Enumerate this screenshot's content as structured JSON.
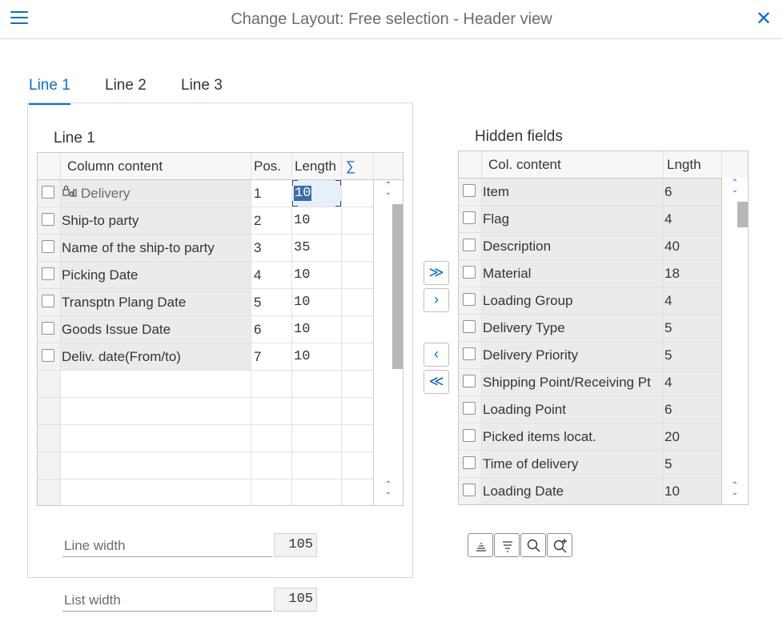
{
  "header": {
    "title": "Change Layout: Free selection - Header view",
    "menu_icon": "hamburger-icon",
    "close_icon": "close-icon",
    "close_glyph": "✕"
  },
  "tabs": [
    {
      "label": "Line 1",
      "active": true
    },
    {
      "label": "Line 2",
      "active": false
    },
    {
      "label": "Line 3",
      "active": false
    }
  ],
  "line_panel": {
    "title": "Line 1",
    "columns": {
      "content": "Column content",
      "pos": "Pos.",
      "length": "Length",
      "sum": "∑"
    },
    "rows": [
      {
        "content": "Delivery",
        "pos": "1",
        "length": "10",
        "key_icon": true
      },
      {
        "content": "Ship-to party",
        "pos": "2",
        "length": "10"
      },
      {
        "content": "Name of the ship-to party",
        "pos": "3",
        "length": "35"
      },
      {
        "content": "Picking Date",
        "pos": "4",
        "length": "10"
      },
      {
        "content": "Transptn Plang Date",
        "pos": "5",
        "length": "10"
      },
      {
        "content": "Goods Issue Date",
        "pos": "6",
        "length": "10"
      },
      {
        "content": "Deliv. date(From/to)",
        "pos": "7",
        "length": "10"
      }
    ],
    "line_width": {
      "label": "Line width",
      "value": "105"
    }
  },
  "list_width": {
    "label": "List width",
    "value": "105"
  },
  "move_buttons": {
    "add_all": "≫",
    "add_one": "›",
    "remove_one": "‹",
    "remove_all": "≪"
  },
  "hidden_panel": {
    "title": "Hidden fields",
    "columns": {
      "content": "Col. content",
      "length": "Lngth"
    },
    "rows": [
      {
        "content": "Item",
        "length": "6"
      },
      {
        "content": "Flag",
        "length": "4"
      },
      {
        "content": "Description",
        "length": "40"
      },
      {
        "content": "Material",
        "length": "18"
      },
      {
        "content": "Loading Group",
        "length": "4"
      },
      {
        "content": "Delivery Type",
        "length": "5"
      },
      {
        "content": "Delivery Priority",
        "length": "5"
      },
      {
        "content": "Shipping Point/Receiving Pt",
        "length": "4"
      },
      {
        "content": "Loading Point",
        "length": "6"
      },
      {
        "content": "Picked items locat.",
        "length": "20"
      },
      {
        "content": "Time of delivery",
        "length": "5"
      },
      {
        "content": "Loading Date",
        "length": "10"
      }
    ]
  },
  "toolbar": [
    "sort-ascending-icon",
    "sort-descending-icon",
    "search-icon",
    "search-next-icon"
  ],
  "colors": {
    "accent": "#0a6ed1",
    "text": "#32363a",
    "muted": "#6a6d70"
  }
}
